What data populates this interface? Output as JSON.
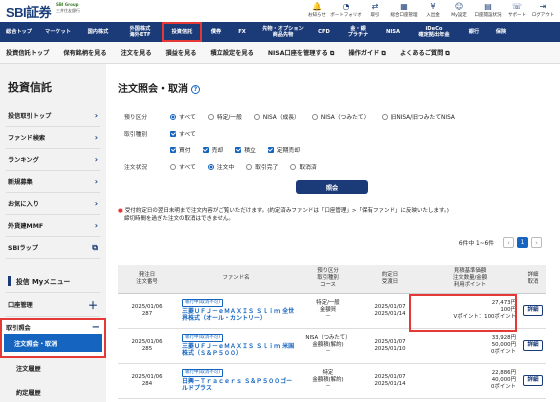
{
  "header": {
    "logo": "SBI証券",
    "logo_sub1": "SBI Group",
    "logo_sub2": "三井住友銀行",
    "top_icons": [
      {
        "icon": "bell-icon",
        "label": "お知らせ"
      },
      {
        "icon": "portfolio-icon",
        "label": "ポートフォリオ"
      },
      {
        "icon": "transfer-icon",
        "label": "取引"
      },
      {
        "icon": "account-icon",
        "label": "総合口座管理"
      },
      {
        "icon": "deposit-icon",
        "label": "入出金"
      },
      {
        "icon": "mypage-icon",
        "label": "My設定"
      },
      {
        "icon": "account-mgmt-icon",
        "label": "口座開設状況"
      },
      {
        "icon": "support-icon",
        "label": "サポート"
      },
      {
        "icon": "logout-icon",
        "label": "ログアウト"
      }
    ]
  },
  "nav": [
    "総合トップ",
    "マーケット",
    "国内株式",
    "外国株式\n海外ETF",
    "投資信託",
    "債券",
    "FX",
    "先物・オプション\n商品先物",
    "CFD",
    "金・銀\nプラチナ",
    "NISA",
    "iDeCo\n確定拠出年金",
    "銀行",
    "保険"
  ],
  "subnav": [
    "投資信託トップ",
    "保有銘柄を見る",
    "注文を見る",
    "損益を見る",
    "積立設定を見る",
    "NISA口座を管理する ⧉",
    "操作ガイド ⧉",
    "よくあるご質問 ⧉"
  ],
  "sidebar": {
    "title": "投資信託",
    "items": [
      "投信取引トップ",
      "ファンド検索",
      "ランキング",
      "新規募集",
      "お気に入り",
      "外貨建MMF",
      "SBIラップ"
    ],
    "my_menu": "投信 Myメニュー",
    "acct": "口座管理",
    "order_inquiry": "取引照会",
    "order_cancel": "注文照会・取消",
    "order_history": "注文履歴",
    "settled": "約定履歴"
  },
  "page": {
    "title": "注文照会・取消",
    "help": "?"
  },
  "form": {
    "acct_label": "預り区分",
    "acct_opts": [
      "すべて",
      "特定/一般",
      "NISA（成長）",
      "NISA（つみたて）",
      "旧NISA/旧つみたてNISA"
    ],
    "type_label": "取引種別",
    "type_all": "すべて",
    "types": [
      "買付",
      "売却",
      "積立",
      "定期売却"
    ],
    "status_label": "注文状況",
    "status_opts": [
      "すべて",
      "注文中",
      "取引完了",
      "取消済"
    ],
    "submit": "照会"
  },
  "note": {
    "l1": "受付約定日の翌日未明まで注文内容がご覧いただけます。(約定済みファンドは「口座管理」>「保有ファンド」に反映いたします。)",
    "l2": "締切時間を過ぎた注文の取消はできません。"
  },
  "pager": {
    "count": "6件中 1~6件",
    "current": "1"
  },
  "table": {
    "headers": [
      "発注日\n注文番号",
      "ファンド名",
      "預り区分\n取引種別\nコース",
      "約定日\n受渡日",
      "見積基準価額\n注文数量/金額\n利用ポイント",
      "詳細\n取消"
    ],
    "rows": [
      {
        "date": "2025/01/06",
        "no": "287",
        "tag": "執行中(取消不可)",
        "fund": "三菱ＵＦＪ－ｅＭＡＸＩＳ Ｓｌｉｍ 全世界株式（オール・カントリー）",
        "acct": "特定/一般",
        "kind": "金額買",
        "course": "－",
        "exec": "2025/01/07",
        "settle": "2025/01/14",
        "a1": "27,473円",
        "a2": "100円",
        "a3": "Vポイント：100ポイント",
        "btn": "詳細"
      },
      {
        "date": "2025/01/06",
        "no": "285",
        "tag": "執行中(取消不可)",
        "fund": "三菱ＵＦＪ－ｅＭＡＸＩＳ Ｓｌｉｍ 米国株式（Ｓ＆Ｐ５００）",
        "acct": "NISA（つみたて）",
        "kind": "金額積(解約)",
        "course": "－",
        "exec": "2025/01/07",
        "settle": "2025/01/10",
        "a1": "33,928円",
        "a2": "50,000円",
        "a3": "0ポイント",
        "btn": "詳細"
      },
      {
        "date": "2025/01/06",
        "no": "284",
        "tag": "執行中(取消不可)",
        "fund": "日興－Ｔｒａｃｅｒｓ Ｓ＆Ｐ５００ゴールドプラス",
        "acct": "特定",
        "kind": "金額積(解約)",
        "course": "－",
        "exec": "2025/01/07",
        "settle": "2025/01/14",
        "a1": "22,886円",
        "a2": "40,000円",
        "a3": "0ポイント",
        "btn": "詳細"
      }
    ]
  }
}
